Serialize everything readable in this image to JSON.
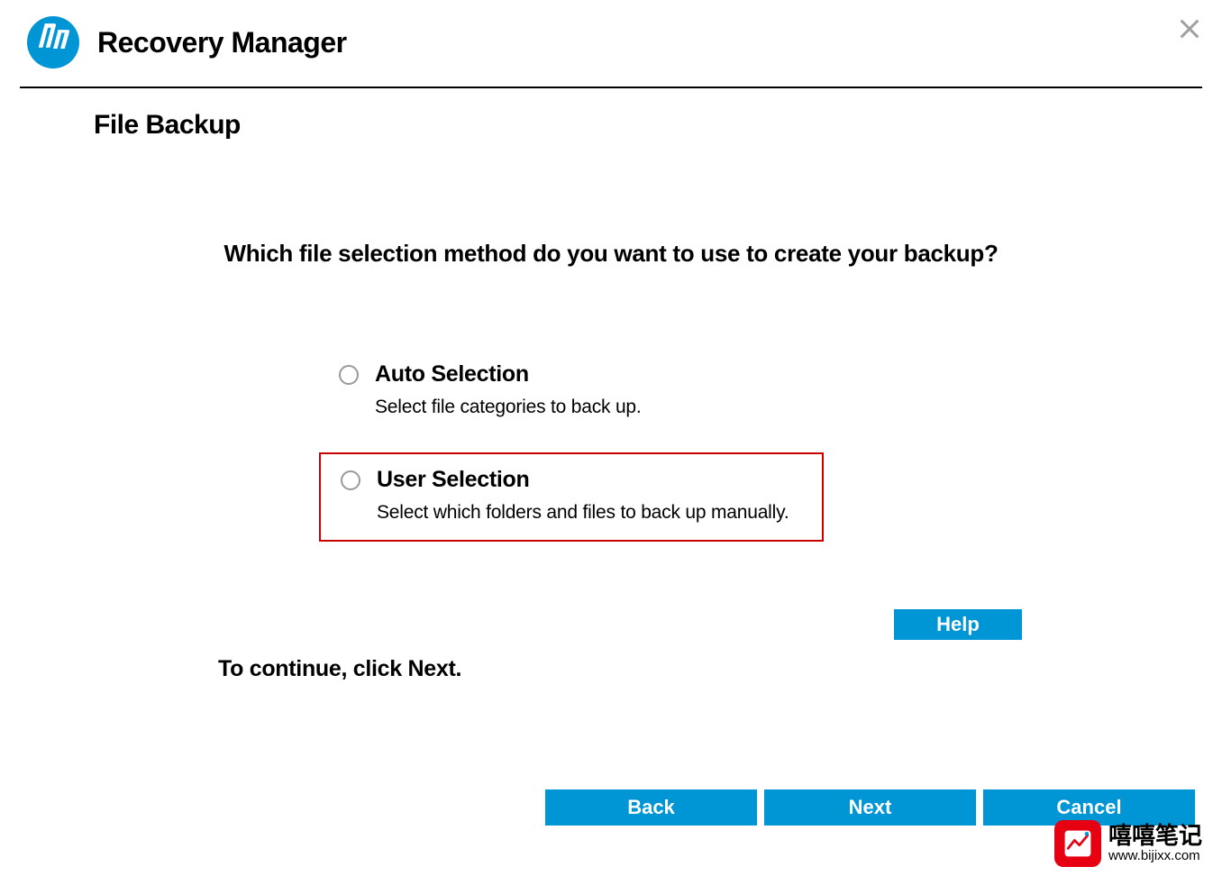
{
  "header": {
    "app_title": "Recovery Manager"
  },
  "page": {
    "title": "File Backup",
    "question": "Which file selection method do you want to use to create your backup?",
    "continue_text": "To continue, click Next."
  },
  "options": {
    "auto": {
      "label": "Auto Selection",
      "desc": "Select file categories to back up."
    },
    "user": {
      "label": "User Selection",
      "desc": "Select which folders and files to back up manually."
    }
  },
  "buttons": {
    "help": "Help",
    "back": "Back",
    "next": "Next",
    "cancel": "Cancel"
  },
  "watermark": {
    "cn": "嘻嘻笔记",
    "url": "www.bijixx.com"
  }
}
